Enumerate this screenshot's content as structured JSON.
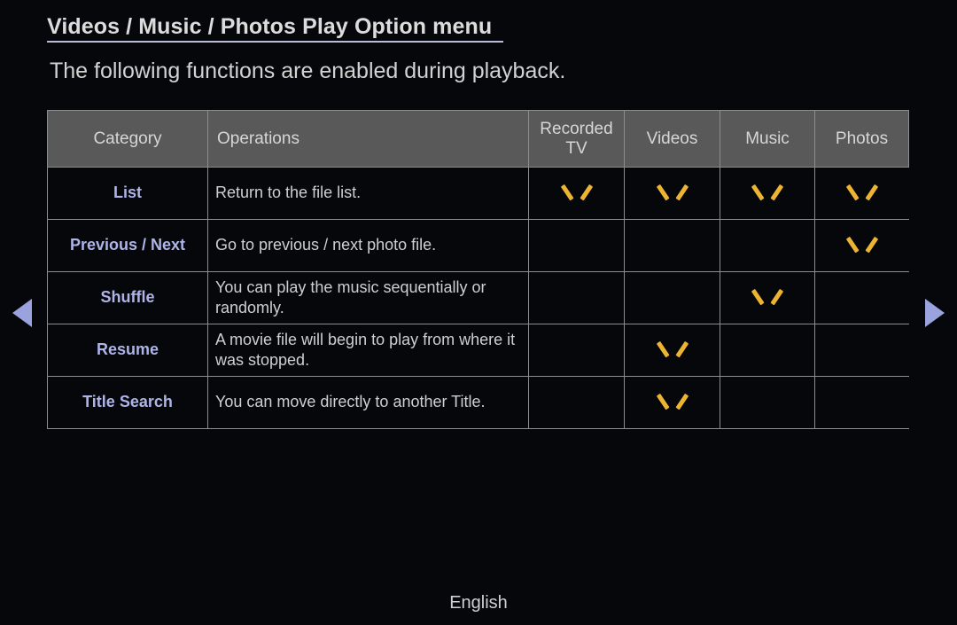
{
  "header": {
    "title": "Videos / Music / Photos Play Option menu",
    "subtitle": "The following functions are enabled during playback."
  },
  "table": {
    "columns": [
      {
        "key": "category",
        "label": "Category"
      },
      {
        "key": "operations",
        "label": "Operations"
      },
      {
        "key": "recorded_tv",
        "label": "Recorded TV"
      },
      {
        "key": "videos",
        "label": "Videos"
      },
      {
        "key": "music",
        "label": "Music"
      },
      {
        "key": "photos",
        "label": "Photos"
      }
    ],
    "rows": [
      {
        "category": "List",
        "operations": "Return to the file list.",
        "recorded_tv": true,
        "videos": true,
        "music": true,
        "photos": true
      },
      {
        "category": "Previous / Next",
        "operations": "Go to previous / next photo file.",
        "recorded_tv": false,
        "videos": false,
        "music": false,
        "photos": true
      },
      {
        "category": "Shuffle",
        "operations": "You can play the music sequentially or randomly.",
        "recorded_tv": false,
        "videos": false,
        "music": true,
        "photos": false
      },
      {
        "category": "Resume",
        "operations": "A movie file will begin to play from where it was stopped.",
        "recorded_tv": false,
        "videos": true,
        "music": false,
        "photos": false
      },
      {
        "category": "Title Search",
        "operations": "You can move directly to another Title.",
        "recorded_tv": false,
        "videos": true,
        "music": false,
        "photos": false
      }
    ],
    "check_icon": "chevron-down-check"
  },
  "navigation": {
    "prev_icon": "triangle-left-icon",
    "next_icon": "triangle-right-icon"
  },
  "footer": {
    "language": "English"
  },
  "colors": {
    "background": "#06070b",
    "header_cell": "#595959",
    "border": "#8d8d8d",
    "category_text": "#aeb4e8",
    "check": "#edb433",
    "arrow": "#9aa3dd"
  }
}
